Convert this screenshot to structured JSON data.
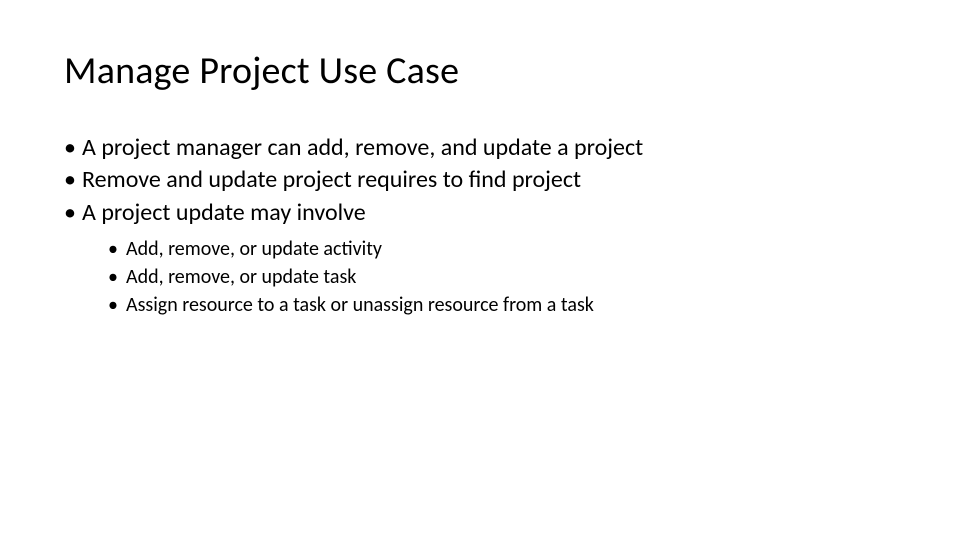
{
  "title": "Manage Project Use Case",
  "bullets": [
    {
      "text": "A project manager can add, remove, and update a project"
    },
    {
      "text": "Remove and update project requires to find project"
    },
    {
      "text": "A project update may involve",
      "sub": [
        "Add, remove, or update activity",
        "Add, remove, or update task",
        "Assign resource to a task or unassign resource from a task"
      ]
    }
  ]
}
